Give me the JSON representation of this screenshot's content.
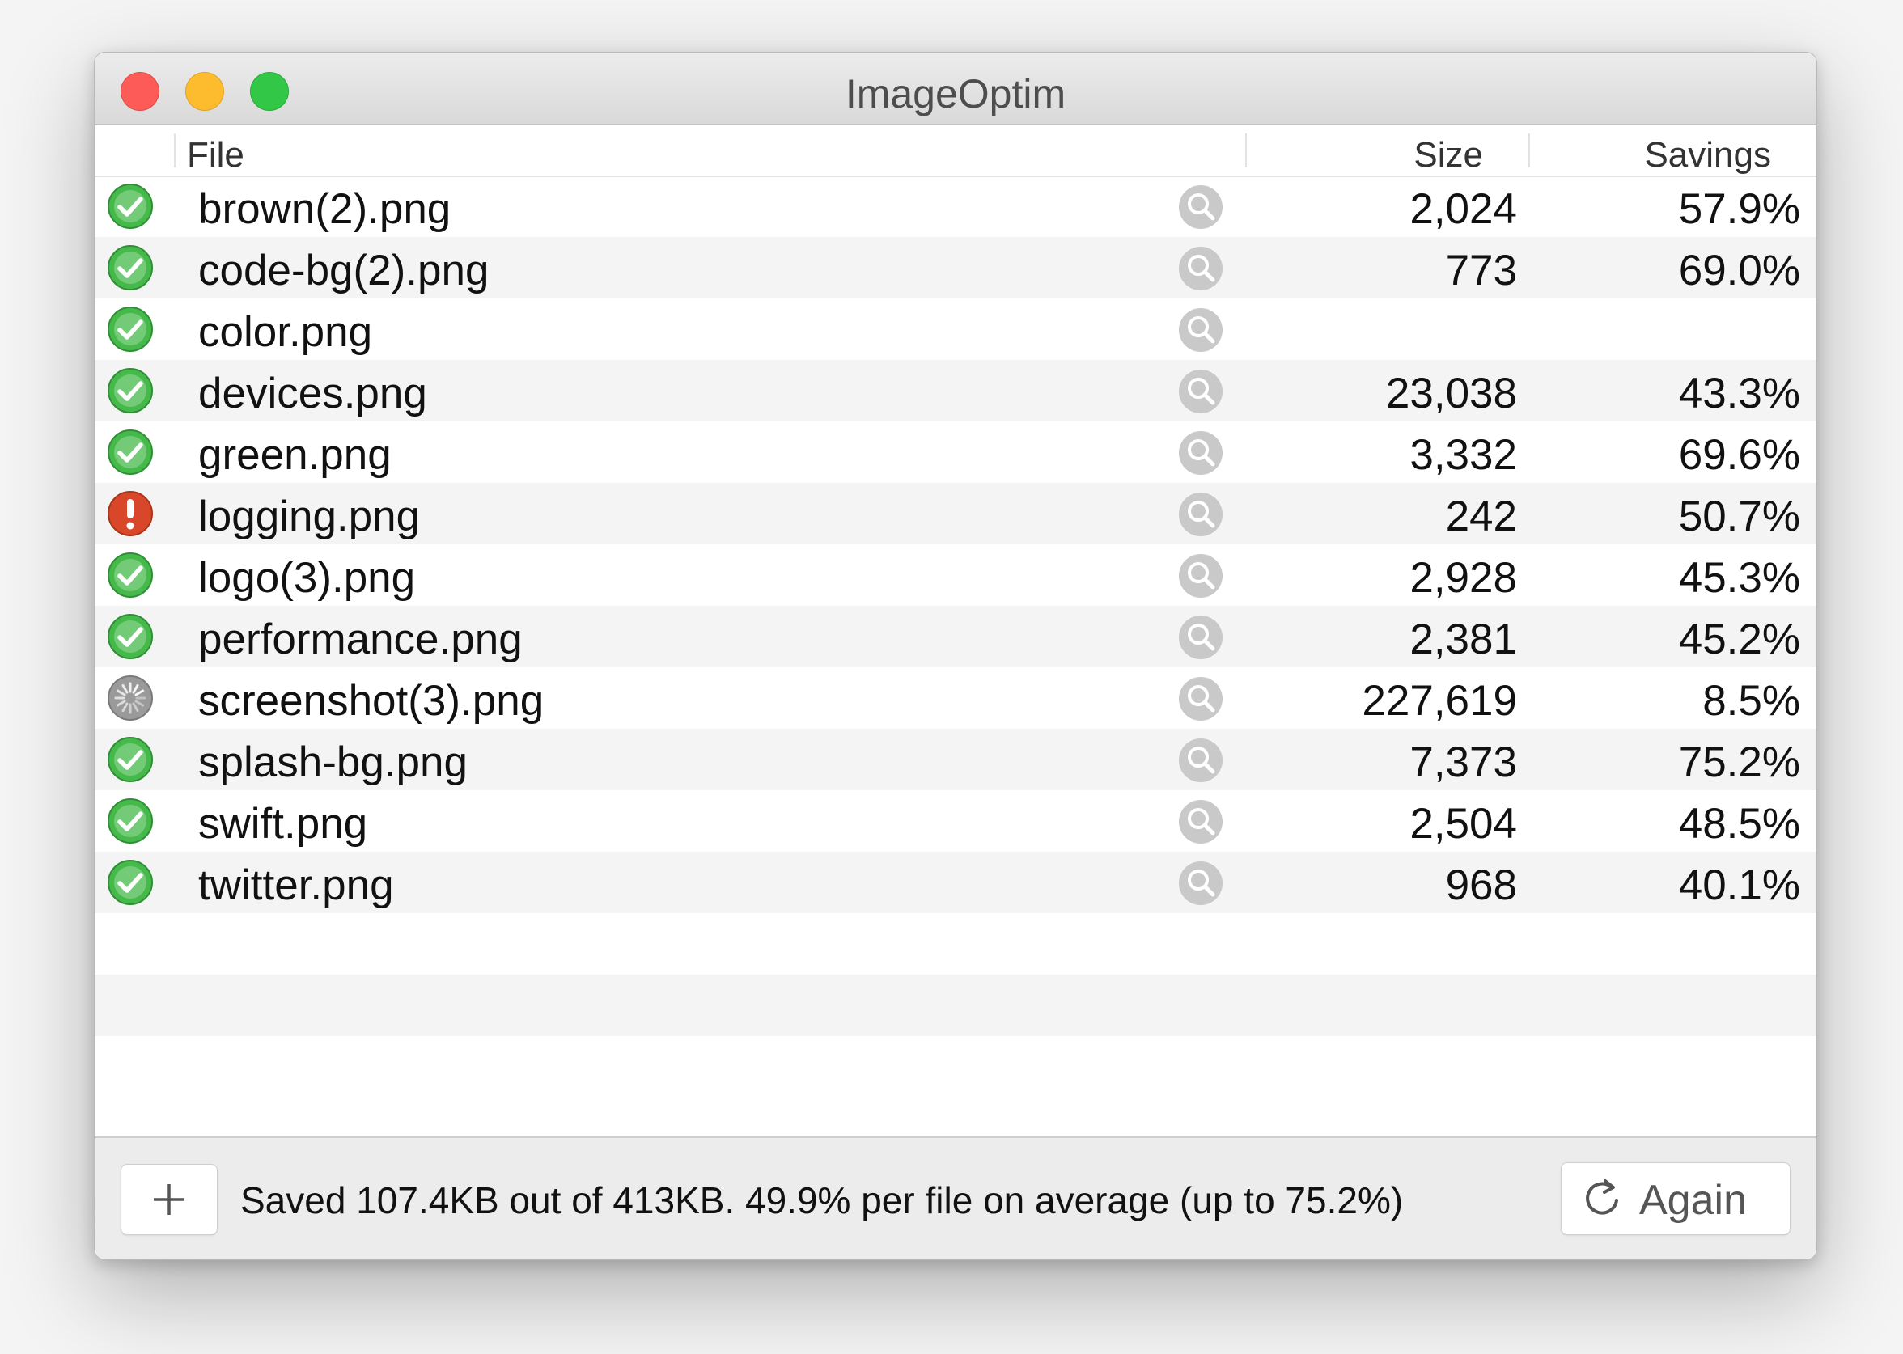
{
  "window": {
    "title": "ImageOptim"
  },
  "columns": {
    "file": "File",
    "size": "Size",
    "savings": "Savings"
  },
  "files": [
    {
      "name": "brown(2).png",
      "size": "2,024",
      "savings": "57.9%",
      "status": "done"
    },
    {
      "name": "code-bg(2).png",
      "size": "773",
      "savings": "69.0%",
      "status": "done"
    },
    {
      "name": "color.png",
      "size": "",
      "savings": "",
      "status": "done"
    },
    {
      "name": "devices.png",
      "size": "23,038",
      "savings": "43.3%",
      "status": "done"
    },
    {
      "name": "green.png",
      "size": "3,332",
      "savings": "69.6%",
      "status": "done"
    },
    {
      "name": "logging.png",
      "size": "242",
      "savings": "50.7%",
      "status": "error"
    },
    {
      "name": "logo(3).png",
      "size": "2,928",
      "savings": "45.3%",
      "status": "done"
    },
    {
      "name": "performance.png",
      "size": "2,381",
      "savings": "45.2%",
      "status": "done"
    },
    {
      "name": "screenshot(3).png",
      "size": "227,619",
      "savings": "8.5%",
      "status": "in-progress"
    },
    {
      "name": "splash-bg.png",
      "size": "7,373",
      "savings": "75.2%",
      "status": "done"
    },
    {
      "name": "swift.png",
      "size": "2,504",
      "savings": "48.5%",
      "status": "done"
    },
    {
      "name": "twitter.png",
      "size": "968",
      "savings": "40.1%",
      "status": "done"
    }
  ],
  "footer": {
    "add_icon": "plus-icon",
    "summary": "Saved 107.4KB out of 413KB. 49.9% per file on average (up to 75.2%)",
    "again_icon": "refresh-icon",
    "again_label": "Again"
  },
  "colors": {
    "status_done": "#45b94a",
    "status_error": "#d9472b",
    "status_progress": "#9a9a9a",
    "zoom_icon": "#c9c9c9",
    "row_alt": "#f4f4f4"
  }
}
